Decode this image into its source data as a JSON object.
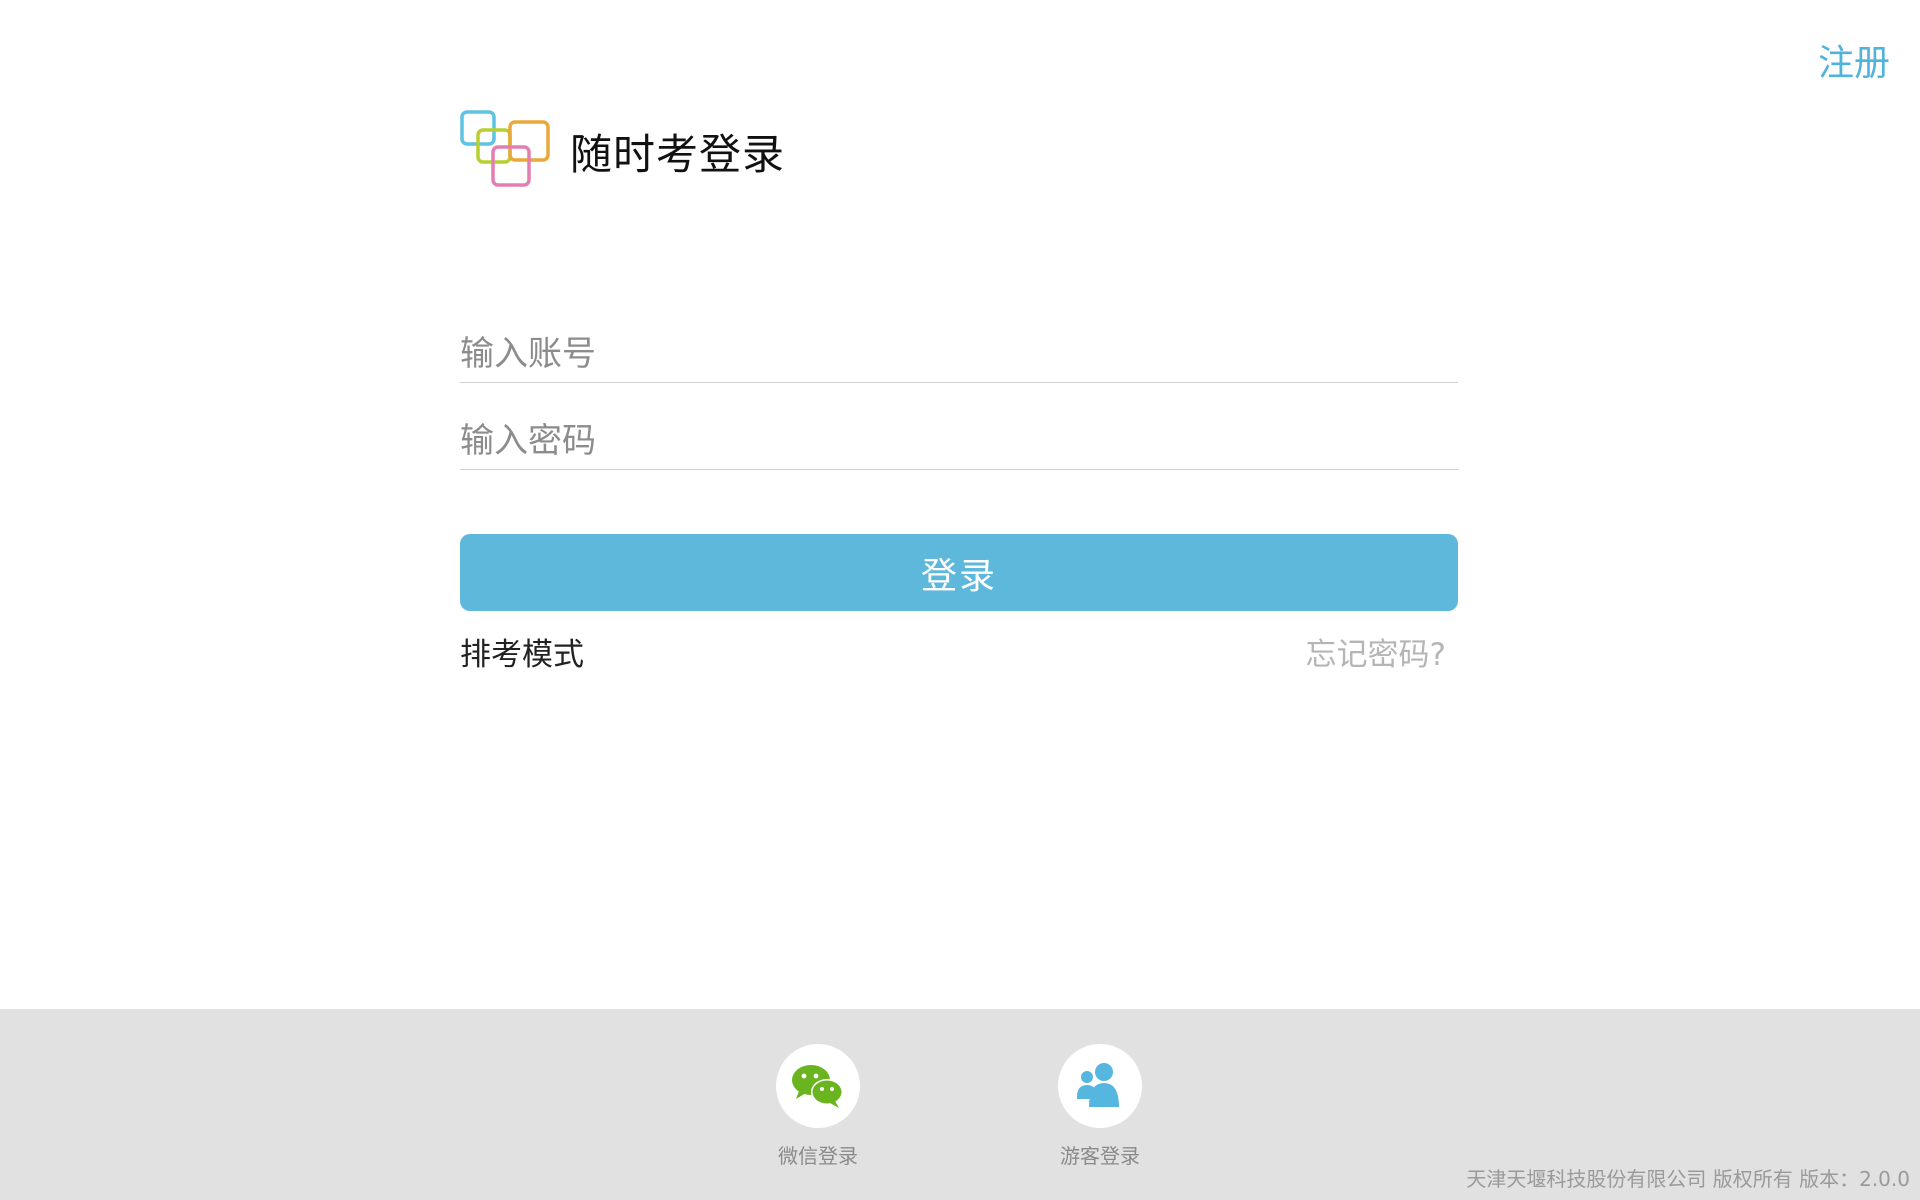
{
  "header": {
    "register_label": "注册"
  },
  "brand": {
    "title": "随时考登录",
    "logo_icon": "overlapping-squares-logo-icon"
  },
  "form": {
    "account_placeholder": "输入账号",
    "account_value": "",
    "password_placeholder": "输入密码",
    "password_value": "",
    "login_label": "登录",
    "exam_mode_label": "排考模式",
    "forgot_label": "忘记密码?"
  },
  "footer": {
    "wechat_label": "微信登录",
    "wechat_icon": "wechat-icon",
    "guest_label": "游客登录",
    "guest_icon": "guest-users-icon",
    "copyright": "天津天堰科技股份有限公司 版权所有  版本：2.0.0"
  },
  "colors": {
    "accent": "#5eb8db",
    "register": "#4fb3dc",
    "wechat_green": "#6ab51f",
    "guest_blue": "#55b6df",
    "footer_bg": "#e1e1e1"
  }
}
